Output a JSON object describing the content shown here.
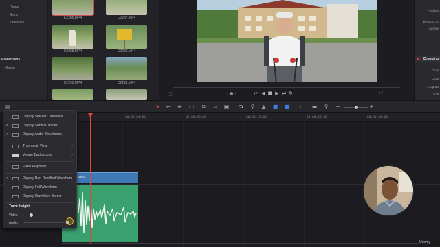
{
  "bins": {
    "items": [
      "Drone",
      "Extra",
      "Timelines"
    ],
    "power_bins_title": "Power Bins",
    "master": "Master"
  },
  "media_pool": {
    "clips": [
      "C2286.MP4",
      "C2287.MP4",
      "C2288.MP4",
      "C2289.MP4",
      "C2290.MP4",
      "C2291.MP4"
    ]
  },
  "inspector": {
    "labels": [
      "Position",
      "Rotation Ar",
      "Anchor",
      "Cropping",
      "Crop",
      "Crop",
      "Crop Bo",
      "Soft"
    ]
  },
  "timeline": {
    "timecodes": [
      "00:00:04:00",
      "00:00:08:00",
      "00:00:12:00",
      "00:00:16:00",
      "00:00:20:00"
    ],
    "clip_label": "MP4"
  },
  "menu": {
    "items": [
      {
        "label": "Display Stacked Timelines",
        "checked": false,
        "submenu": false
      },
      {
        "label": "Display Subtitle Tracks",
        "checked": true,
        "submenu": false
      },
      {
        "label": "Display Audio Waveforms",
        "checked": true,
        "submenu": false
      },
      {
        "label": "Thumbnail View",
        "checked": false,
        "submenu": true
      },
      {
        "label": "Viewer Background",
        "checked": false,
        "submenu": true
      },
      {
        "label": "Fixed Playhead",
        "checked": false,
        "submenu": false
      },
      {
        "label": "Display Non-Rectified Waveform",
        "checked": true,
        "submenu": false
      },
      {
        "label": "Display Full Waveform",
        "checked": false,
        "submenu": false
      },
      {
        "label": "Display Waveform Border",
        "checked": false,
        "submenu": false
      }
    ],
    "track_height_title": "Track Height",
    "video_label": "Video",
    "audio_label": "Audio",
    "video_level": 0.15,
    "audio_level": 0.98
  },
  "watermark": "Udemy",
  "colors": {
    "playhead": "#e0463f",
    "video_clip": "#3e78b5",
    "audio_clip": "#3aa06e",
    "accent": "#d8b21f"
  }
}
